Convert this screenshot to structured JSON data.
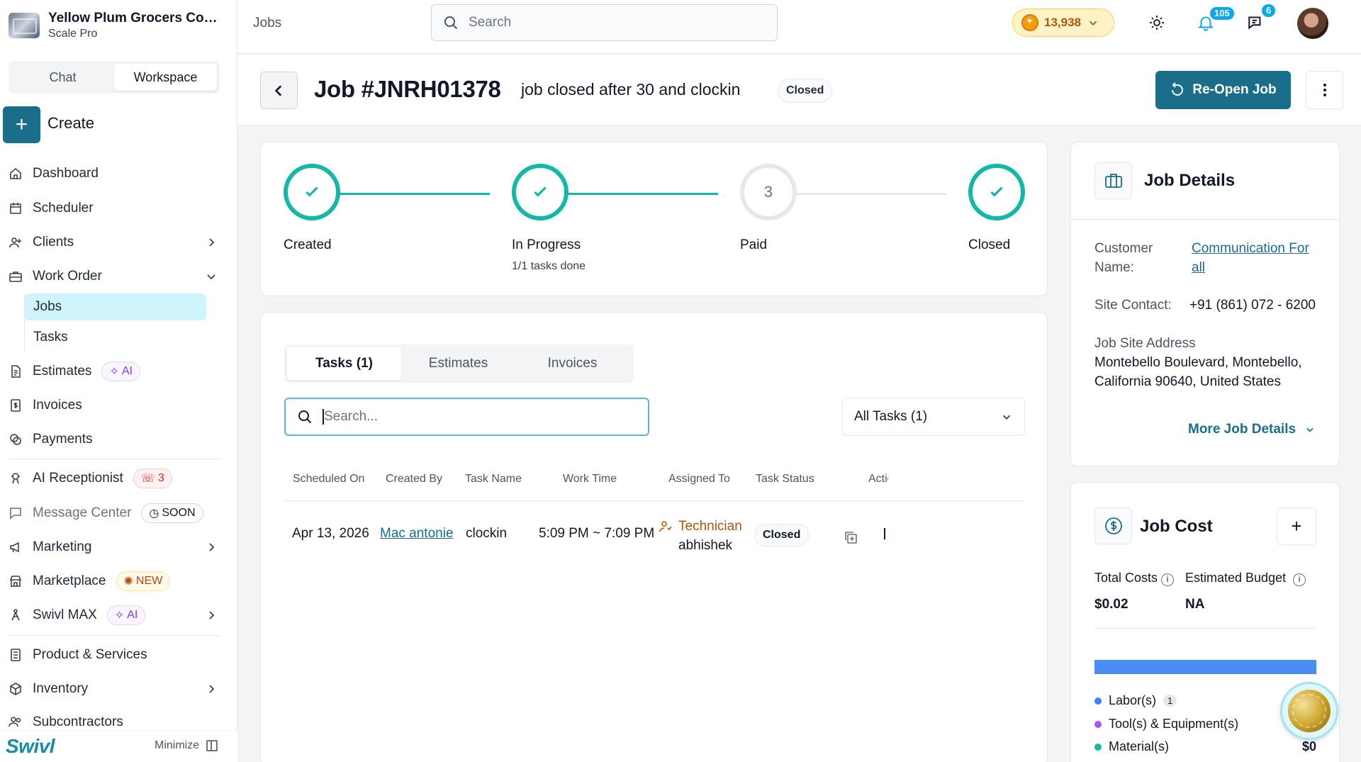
{
  "org": {
    "name": "Yellow Plum Grocers Com...",
    "plan": "Scale Pro"
  },
  "sidebar": {
    "segments": [
      "Chat",
      "Workspace"
    ],
    "create_label": "Create",
    "items": {
      "dashboard": "Dashboard",
      "scheduler": "Scheduler",
      "clients": "Clients",
      "work_order": "Work Order",
      "jobs": "Jobs",
      "tasks": "Tasks",
      "estimates": "Estimates",
      "estimates_badge": "AI",
      "invoices": "Invoices",
      "payments": "Payments",
      "ai_receptionist": "AI Receptionist",
      "ai_receptionist_badge": "3",
      "message_center": "Message Center",
      "message_center_badge": "SOON",
      "marketing": "Marketing",
      "marketplace": "Marketplace",
      "marketplace_badge": "NEW",
      "swivl_max": "Swivl MAX",
      "swivl_max_badge": "AI",
      "products": "Product & Services",
      "inventory": "Inventory",
      "subcontractors": "Subcontractors"
    },
    "brand": "Swivl",
    "minimize": "Minimize"
  },
  "topbar": {
    "breadcrumb": "Jobs",
    "search_placeholder": "Search",
    "coins": "13,938",
    "notifications": "105",
    "messages": "6"
  },
  "job": {
    "title": "Job #JNRH01378",
    "subtitle": "job closed after 30 and clockin",
    "status": "Closed",
    "reopen_label": "Re-Open Job"
  },
  "progress": {
    "steps": [
      {
        "label": "Created",
        "sub": ""
      },
      {
        "label": "In Progress",
        "sub": "1/1 tasks done"
      },
      {
        "label": "Paid",
        "sub": "",
        "number": "3"
      },
      {
        "label": "Closed",
        "sub": ""
      }
    ]
  },
  "tasks": {
    "tabs": [
      "Tasks (1)",
      "Estimates",
      "Invoices"
    ],
    "search_placeholder": "Search...",
    "filter": "All Tasks (1)",
    "columns": [
      "Scheduled On",
      "Created By",
      "Task Name",
      "Work Time",
      "Assigned To",
      "Task Status",
      "Actic"
    ],
    "rows": [
      {
        "scheduled_on": "Apr 13, 2026",
        "created_by": "Mac antonie",
        "task_name": "clockin",
        "work_time": "5:09 PM ~ 7:09 PM",
        "assigned_role": "Technician",
        "assigned_name": "abhishek",
        "status": "Closed"
      }
    ]
  },
  "job_details": {
    "title": "Job Details",
    "customer_label": "Customer Name:",
    "customer_value": "Communication For all",
    "site_contact_label": "Site Contact:",
    "site_contact_value": "+91 (861) 072 - 6200",
    "address_label": "Job Site Address",
    "address_value": "Montebello Boulevard, Montebello, California 90640, United States",
    "more_label": "More Job Details"
  },
  "job_cost": {
    "title": "Job Cost",
    "total_label": "Total Costs",
    "total_value": "$0.02",
    "budget_label": "Estimated Budget",
    "budget_value": "NA",
    "legend": [
      {
        "label": "Labor(s)",
        "count": "1",
        "color": "#3b82f6"
      },
      {
        "label": "Tool(s) & Equipment(s)",
        "color": "#a855f7"
      },
      {
        "label": "Material(s)",
        "value": "$0",
        "color": "#14b8a6"
      }
    ]
  },
  "colors": {
    "primary": "#1b6e8a",
    "step_done": "#14b8a6",
    "active_nav": "#cff5fb"
  }
}
